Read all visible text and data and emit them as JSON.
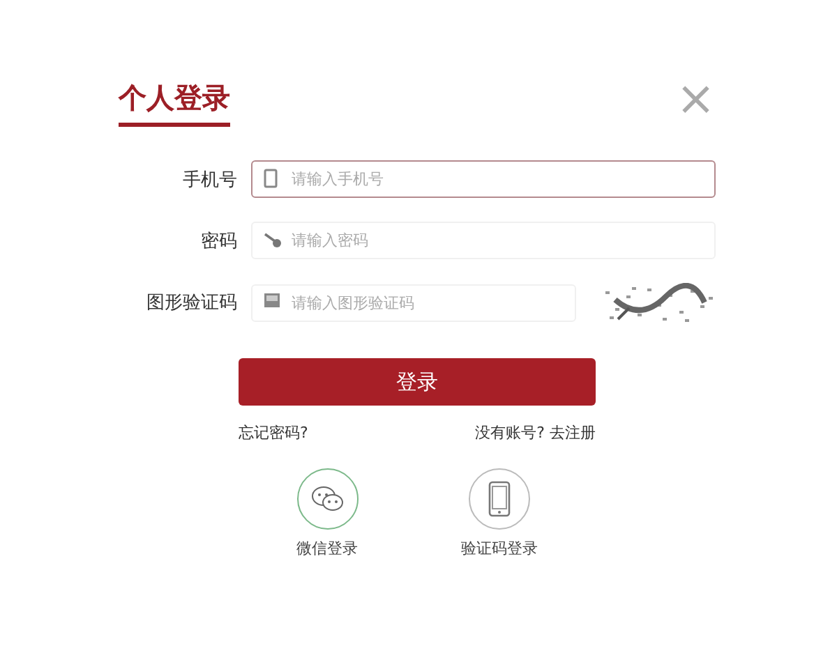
{
  "dialog": {
    "title": "个人登录",
    "close": "×"
  },
  "fields": [
    {
      "kind": "phone",
      "label": "手机号",
      "placeholder": "请输入手机号",
      "focused": true
    },
    {
      "kind": "password",
      "label": "密码",
      "placeholder": "请输入密码",
      "focused": false
    },
    {
      "kind": "captcha",
      "label": "图形验证码",
      "placeholder": "请输入图形验证码",
      "focused": false
    }
  ],
  "submit": "登录",
  "links": {
    "forgot": "忘记密码?",
    "register": "没有账号? 去注册"
  },
  "alt_logins": [
    {
      "kind": "wechat",
      "label": "微信登录"
    },
    {
      "kind": "sms",
      "label": "验证码登录"
    }
  ]
}
